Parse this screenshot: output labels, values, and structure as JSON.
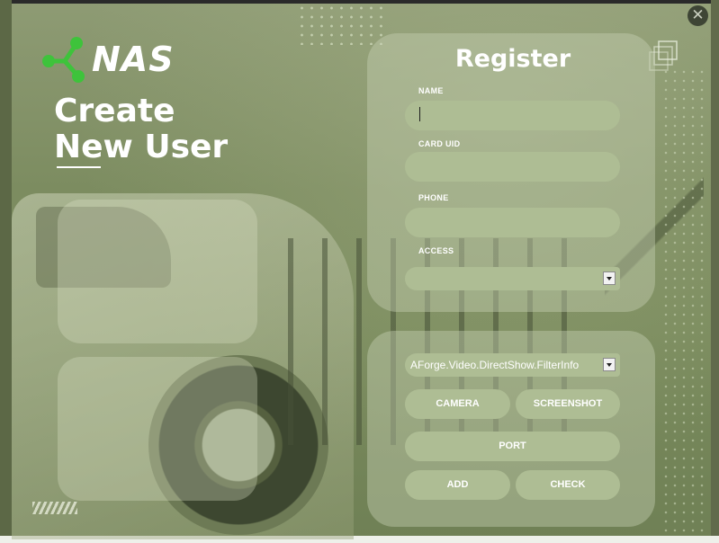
{
  "window": {
    "close_glyph": "✕",
    "close_icon": "close-icon"
  },
  "branding": {
    "logo_text": "NAS",
    "logo_icon": "network-nodes-icon",
    "logo_color": "#3ec33b",
    "headline_line1": "Create",
    "headline_line2": "New User"
  },
  "register": {
    "title": "Register",
    "name_label": "NAME",
    "name_value": "",
    "card_uid_label": "CARD UID",
    "card_uid_value": "",
    "phone_label": "PHONE",
    "phone_value": "",
    "access_label": "ACCESS",
    "access_value": ""
  },
  "camera": {
    "device_value": "AForge.Video.DirectShow.FilterInfo",
    "camera_label": "CAMERA",
    "screenshot_label": "SCREENSHOT",
    "port_label": "PORT",
    "add_label": "ADD",
    "check_label": "CHECK"
  },
  "colors": {
    "field_fill": "#aebd94",
    "panel_fill": "#c8d2b4",
    "text": "#ffffff"
  }
}
